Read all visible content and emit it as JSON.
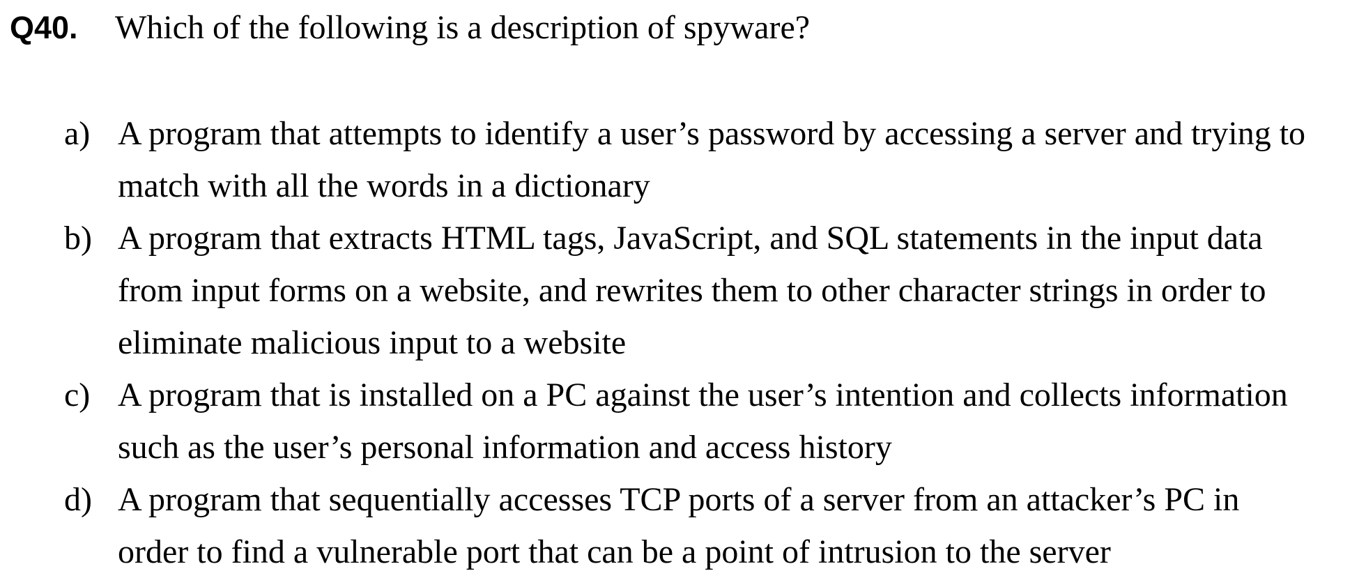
{
  "question": {
    "number": "Q40.",
    "text": "Which of the following is a description of spyware?"
  },
  "options": [
    {
      "letter": "a)",
      "text": "A program that attempts to identify a user’s password by accessing a server and trying to\nmatch with all the words in a dictionary"
    },
    {
      "letter": "b)",
      "text": "A program that extracts HTML tags, JavaScript, and SQL statements in the input data\nfrom input forms on a website, and rewrites them to other character strings in order to\neliminate malicious input to a website"
    },
    {
      "letter": "c)",
      "text": "A program that is installed on a PC against the user’s intention and collects information\nsuch as the user’s personal information and access history"
    },
    {
      "letter": "d)",
      "text": "A program that sequentially accesses TCP ports of a server from an attacker’s PC in\norder to find a vulnerable port that can be a point of intrusion to the server"
    }
  ]
}
